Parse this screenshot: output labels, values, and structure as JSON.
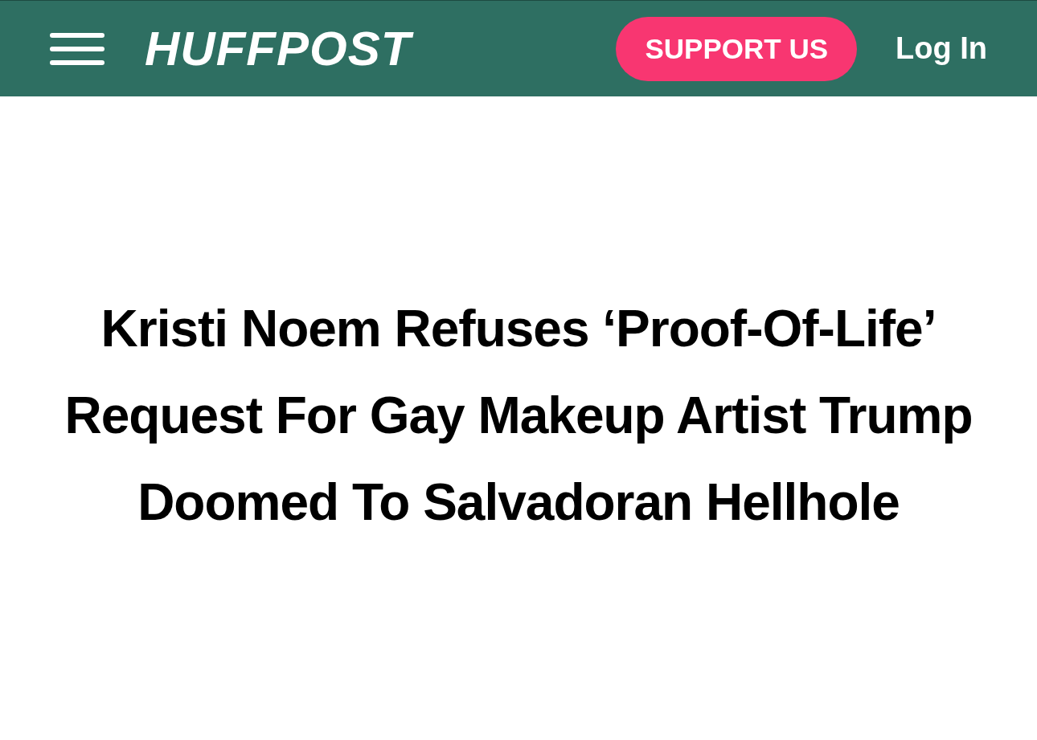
{
  "header": {
    "logo": "HUFFPOST",
    "support_button": "SUPPORT US",
    "login_link": "Log In"
  },
  "article": {
    "headline": "Kristi Noem Refuses ‘Proof-Of-Life’ Request For Gay Makeup Artist Trump Doomed To Salvadoran Hellhole"
  }
}
